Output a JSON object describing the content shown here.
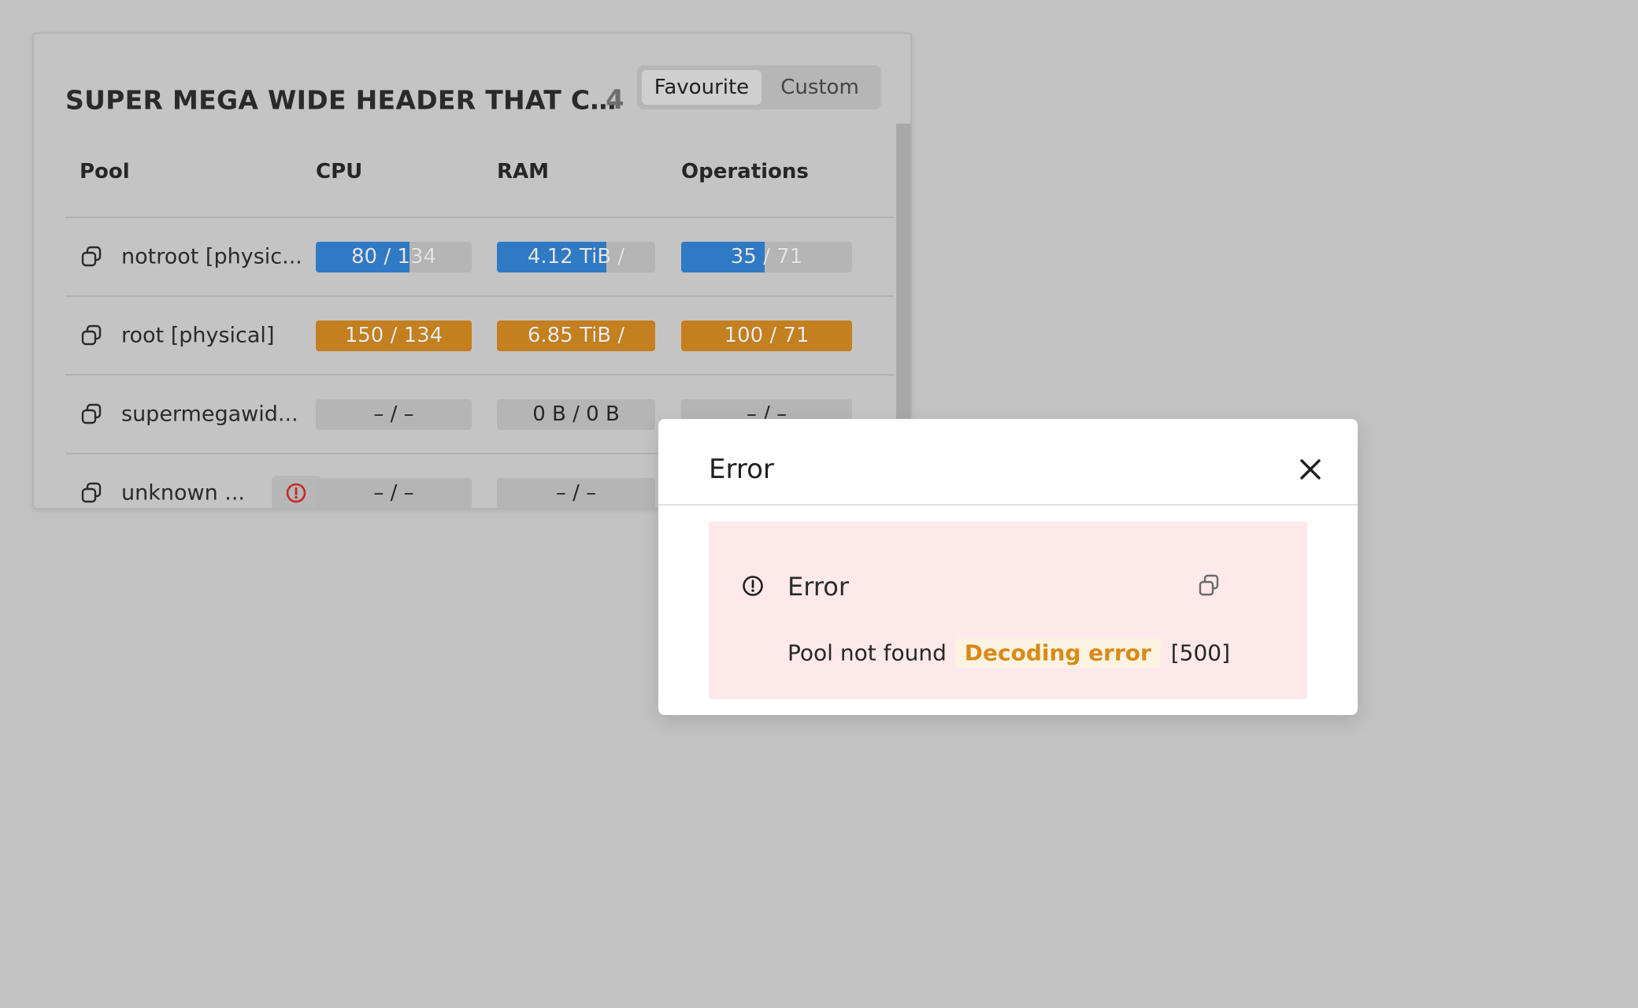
{
  "card": {
    "title": "SUPER MEGA WIDE HEADER THAT CA...",
    "count": "4",
    "tabs": [
      {
        "label": "Favourite",
        "active": true
      },
      {
        "label": "Custom",
        "active": false
      }
    ]
  },
  "table": {
    "columns": [
      "Pool",
      "CPU",
      "RAM",
      "Operations"
    ],
    "rows": [
      {
        "pool": "notroot [physic...",
        "cpu": {
          "label": "80 / 134",
          "fill": 0.6,
          "color": "#2f7ac4"
        },
        "ram": {
          "label": "4.12 TiB /",
          "fill": 0.69,
          "color": "#2f7ac4"
        },
        "ops": {
          "label": "35 / 71",
          "fill": 0.49,
          "color": "#2f7ac4"
        }
      },
      {
        "pool": "root [physical]",
        "cpu": {
          "label": "150 / 134",
          "fill": 1.0,
          "color": "#c47f1e"
        },
        "ram": {
          "label": "6.85 TiB /",
          "fill": 1.0,
          "color": "#c47f1e"
        },
        "ops": {
          "label": "100 / 71",
          "fill": 1.0,
          "color": "#c47f1e"
        }
      },
      {
        "pool": "supermegawid...",
        "cpu": {
          "label": "– / –",
          "fill": 0,
          "color": ""
        },
        "ram": {
          "label": "0 B / 0 B",
          "fill": 0,
          "color": ""
        },
        "ops": {
          "label": "– / –",
          "fill": 0,
          "color": ""
        }
      },
      {
        "pool": "unknown ...",
        "warning": true,
        "cpu": {
          "label": "– / –",
          "fill": 0,
          "color": ""
        },
        "ram": {
          "label": "– / –",
          "fill": 0,
          "color": ""
        },
        "ops": {
          "label": "– / –",
          "fill": 0,
          "color": ""
        }
      }
    ]
  },
  "modal": {
    "title": "Error",
    "alert": {
      "title": "Error",
      "message": "Pool not found",
      "tag": "Decoding error",
      "code": "[500]"
    }
  },
  "icons": {
    "pool": "copy-icon",
    "warning": "alert-circle-icon",
    "close": "close-icon",
    "alert": "alert-circle-icon",
    "copy": "copy-icon"
  }
}
